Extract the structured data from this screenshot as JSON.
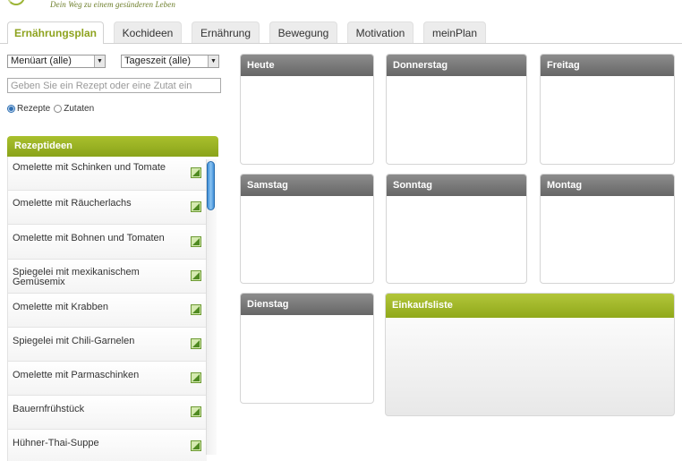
{
  "header": {
    "slogan": "Dein Weg zu einem gesünderen Leben"
  },
  "tabs": [
    {
      "label": "Ernährungsplan",
      "active": true
    },
    {
      "label": "Kochideen",
      "active": false
    },
    {
      "label": "Ernährung",
      "active": false
    },
    {
      "label": "Bewegung",
      "active": false
    },
    {
      "label": "Motivation",
      "active": false
    },
    {
      "label": "meinPlan",
      "active": false
    }
  ],
  "filters": {
    "menuart": "Menüart (alle)",
    "tageszeit": "Tageszeit (alle)",
    "search_placeholder": "Geben Sie ein Rezept oder eine Zutat ein",
    "radio_rezepte": "Rezepte",
    "radio_zutaten": "Zutaten",
    "selected_radio": "Rezepte"
  },
  "rezeptideen": {
    "title": "Rezeptideen",
    "items": [
      "Omelette mit Schinken und Tomate",
      "Omelette mit Räucherlachs",
      "Omelette mit Bohnen und Tomaten",
      "Spiegelei mit mexikanischem Gemüsemix",
      "Omelette mit Krabben",
      "Spiegelei mit Chili-Garnelen",
      "Omelette mit Parmaschinken",
      "Bauernfrühstück",
      "Hühner-Thai-Suppe"
    ]
  },
  "plan": {
    "days": [
      "Heute",
      "Donnerstag",
      "Freitag",
      "Samstag",
      "Sonntag",
      "Montag",
      "Dienstag"
    ],
    "einkaufsliste": "Einkaufsliste"
  },
  "colors": {
    "accent_green": "#9cb62a",
    "active_tab_text": "#8ea31f",
    "day_header": "#777777"
  }
}
